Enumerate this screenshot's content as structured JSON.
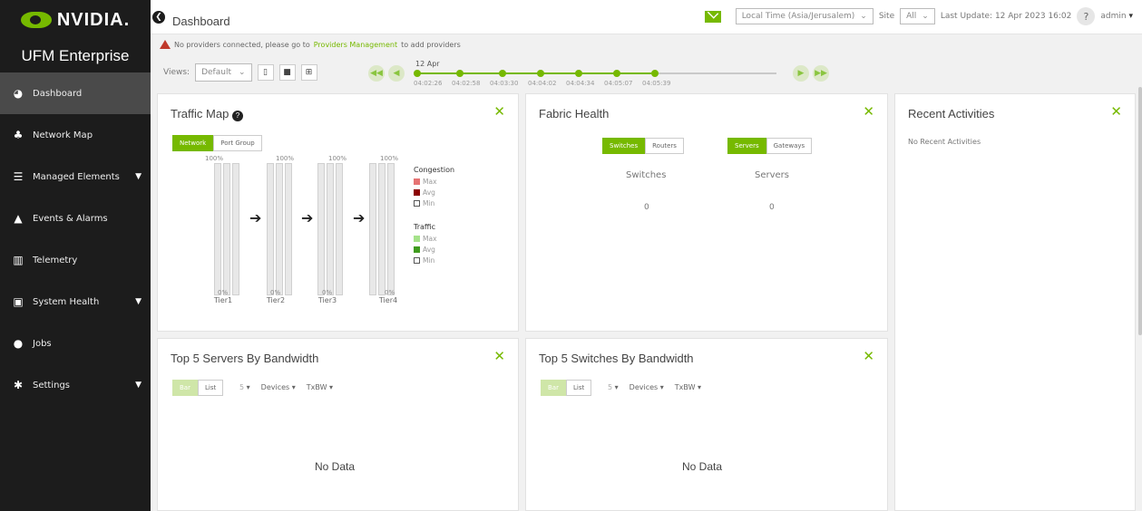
{
  "sidebar": {
    "brand": "NVIDIA.",
    "product": "UFM Enterprise",
    "items": [
      {
        "label": "Dashboard",
        "active": true,
        "chevron": false
      },
      {
        "label": "Network Map",
        "active": false,
        "chevron": false
      },
      {
        "label": "Managed Elements",
        "active": false,
        "chevron": true
      },
      {
        "label": "Events & Alarms",
        "active": false,
        "chevron": false
      },
      {
        "label": "Telemetry",
        "active": false,
        "chevron": false
      },
      {
        "label": "System Health",
        "active": false,
        "chevron": true
      },
      {
        "label": "Jobs",
        "active": false,
        "chevron": false
      },
      {
        "label": "Settings",
        "active": false,
        "chevron": true
      }
    ]
  },
  "topbar": {
    "page_title": "Dashboard",
    "timezone": "Local Time (Asia/Jerusalem)",
    "site_label": "Site",
    "site_value": "All",
    "last_update": "Last Update: 12 Apr 2023 16:02",
    "help": "?",
    "user": "admin"
  },
  "warning": {
    "prefix": "No providers connected, please go to",
    "link": "Providers Management",
    "suffix": "to add providers"
  },
  "views": {
    "label": "Views:",
    "selected": "Default"
  },
  "timeline": {
    "date": "12 Apr",
    "times": [
      "04:02:26",
      "04:02:58",
      "04:03:30",
      "04:04:02",
      "04:04:34",
      "04:05:07",
      "04:05:39"
    ]
  },
  "traffic_map": {
    "title": "Traffic Map",
    "tabs": [
      "Network",
      "Port Group"
    ],
    "tiers": [
      {
        "name": "Tier1",
        "top": "100%",
        "bottom": "0%"
      },
      {
        "name": "Tier2",
        "top": "100%",
        "bottom": "0%"
      },
      {
        "name": "Tier3",
        "top": "100%",
        "bottom": "0%"
      },
      {
        "name": "Tier4",
        "top": "100%",
        "bottom": "0%"
      }
    ],
    "legend": {
      "congestion_title": "Congestion",
      "congestion": [
        "Max",
        "Avg",
        "Min"
      ],
      "traffic_title": "Traffic",
      "traffic": [
        "Max",
        "Avg",
        "Min"
      ]
    }
  },
  "fabric_health": {
    "title": "Fabric Health",
    "left_tabs": [
      "Switches",
      "Routers"
    ],
    "right_tabs": [
      "Servers",
      "Gateways"
    ],
    "switches_label": "Switches",
    "switches_value": "0",
    "servers_label": "Servers",
    "servers_value": "0"
  },
  "recent_activities": {
    "title": "Recent Activities",
    "empty": "No Recent Activities"
  },
  "top_servers": {
    "title": "Top 5 Servers By Bandwidth",
    "tabs": [
      "Bar",
      "List"
    ],
    "count": "5",
    "devices": "Devices",
    "metric": "TxBW",
    "empty": "No Data"
  },
  "top_switches": {
    "title": "Top 5 Switches By Bandwidth",
    "tabs": [
      "Bar",
      "List"
    ],
    "count": "5",
    "devices": "Devices",
    "metric": "TxBW",
    "empty": "No Data"
  },
  "colors": {
    "accent": "#76b900",
    "sidebar": "#1c1c1c",
    "congestion_max": "#e57373",
    "congestion_avg": "#8b0000",
    "traffic_max": "#a5e28a",
    "traffic_avg": "#3f9b1d"
  }
}
